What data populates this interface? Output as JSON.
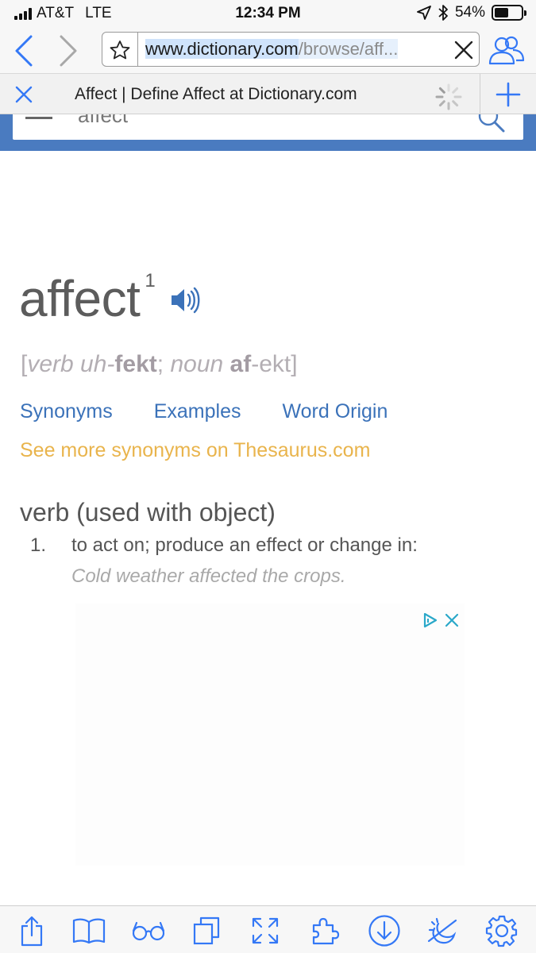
{
  "status_bar": {
    "carrier": "AT&T",
    "network": "LTE",
    "time": "12:34 PM",
    "battery": "54%",
    "battery_level": 0.54
  },
  "browser": {
    "url_highlighted": "www.dictionary.com",
    "url_rest": "/browse/aff...",
    "tab_title": "Affect | Define Affect at Dictionary.com"
  },
  "site": {
    "search_value": "affect"
  },
  "entry": {
    "headword": "affect",
    "homograph": "1",
    "pronunciation": {
      "open": "[",
      "verb_label": "verb",
      "verb_pre": "uh-",
      "verb_stress": "fekt",
      "sep": ";",
      "noun_label": "noun",
      "noun_stress": "af",
      "noun_post": "-ekt",
      "close": "]"
    },
    "links": [
      "Synonyms",
      "Examples",
      "Word Origin"
    ],
    "thesaurus_link": "See more synonyms on Thesaurus.com",
    "part_of_speech": "verb (used with object)",
    "definitions": [
      {
        "number": "1.",
        "text": "to act on; produce an effect or change in:",
        "example": "Cold weather affected the crops."
      }
    ]
  },
  "colors": {
    "accent_blue": "#3b72b9",
    "header_blue": "#4a7bc0",
    "thesaurus_gold": "#e9b44c",
    "ios_blue": "#3478f6"
  },
  "icons": {
    "toolbar": [
      "share-icon",
      "reader-icon",
      "glasses-icon",
      "tabs-icon",
      "fullscreen-icon",
      "extensions-icon",
      "download-icon",
      "night-mode-icon",
      "settings-icon"
    ]
  }
}
